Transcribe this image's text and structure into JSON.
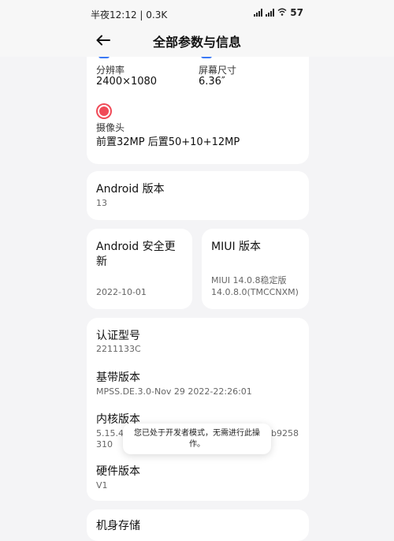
{
  "status": {
    "time_text": "半夜12:12 | 0.3K",
    "battery": "57"
  },
  "header": {
    "title": "全部参数与信息"
  },
  "display_card": {
    "resolution_label": "分辨率",
    "resolution_value": "2400×1080",
    "screen_size_label": "屏幕尺寸",
    "screen_size_value": "6.36″",
    "camera_label": "摄像头",
    "camera_value": "前置32MP 后置50+10+12MP"
  },
  "android_version": {
    "label": "Android 版本",
    "value": "13"
  },
  "security_update": {
    "label": "Android 安全更新",
    "value": "2022-10-01"
  },
  "miui_version": {
    "label": "MIUI 版本",
    "value": "MIUI 14.0.8稳定版 14.0.8.0(TMCCNXM)"
  },
  "details": {
    "model_label": "认证型号",
    "model_value": "2211133C",
    "baseband_label": "基带版本",
    "baseband_value": "MPSS.DE.3.0-Nov 29 2022-22:26:01",
    "kernel_label": "内核版本",
    "kernel_value_start": "5.15.41-",
    "kernel_value_end": "b9258",
    "kernel_value_line2": "310",
    "hardware_label": "硬件版本",
    "hardware_value": "V1"
  },
  "next_card": {
    "label": "机身存储"
  },
  "toast": {
    "message": "您已处于开发者模式，无需进行此操作。"
  }
}
